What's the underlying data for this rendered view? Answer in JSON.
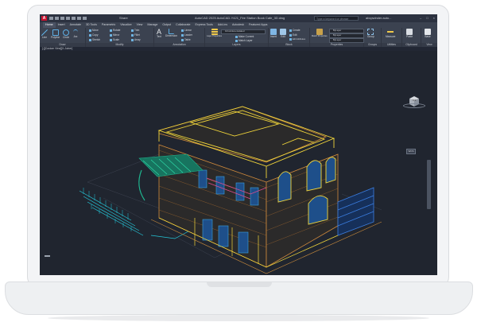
{
  "titlebar": {
    "logo": "A",
    "share": "Share",
    "title": "AutoCAD 2025   AutoCAD-Y421_Fire Station Book Cafe_3D.dwg",
    "search_placeholder": "Type a keyword or phrase",
    "user": "abcpwinder.auto..."
  },
  "tabs": [
    "Home",
    "Insert",
    "Annotate",
    "3D Tools",
    "Parametric",
    "Visualize",
    "View",
    "Manage",
    "Output",
    "Collaborate",
    "Express Tools",
    "Add-ins",
    "Autodesk",
    "Featured Apps"
  ],
  "ribbon": {
    "draw": {
      "label": "Draw",
      "tools": [
        "Line",
        "Polyline",
        "Circle",
        "Arc"
      ]
    },
    "modify": {
      "label": "Modify",
      "items": [
        "Move",
        "Rotate",
        "Trim",
        "Copy",
        "Mirror",
        "Fillet",
        "Stretch",
        "Scale",
        "Array"
      ]
    },
    "annotation": {
      "label": "Annotation",
      "tools": [
        "Text",
        "Dimension"
      ],
      "items": [
        "Linear",
        "Leader",
        "Table"
      ]
    },
    "layers": {
      "label": "Layers",
      "tool": "Layer Properties",
      "current": "0-Furniture-Isolated",
      "items": [
        "Make Current",
        "Match Layer"
      ]
    },
    "block": {
      "label": "Block",
      "tools": [
        "Insert",
        "Edit"
      ],
      "items": [
        "Create",
        "Edit",
        "Edit Attributes"
      ]
    },
    "properties": {
      "label": "Properties",
      "tool": "Match Properties",
      "values": [
        "ByLayer",
        "ByLayer",
        "ByLayer"
      ]
    },
    "groups": {
      "label": "Groups",
      "tool": "Group"
    },
    "utilities": {
      "label": "Utilities",
      "tool": "Measure"
    },
    "clipboard": {
      "label": "Clipboard",
      "tool": "Paste"
    },
    "view": {
      "label": "View",
      "tool": "Base"
    }
  },
  "filetab": "[-][Custom View][X-Joiner]",
  "viewcube_label": "TOP",
  "wcs_label": "WCS",
  "colors": {
    "cyan": "#23c5d9",
    "yellow": "#f1d53a",
    "orange": "#d08a3c",
    "teal": "#1fb58f",
    "magenta": "#e04c8f",
    "blue": "#3b7de0"
  }
}
